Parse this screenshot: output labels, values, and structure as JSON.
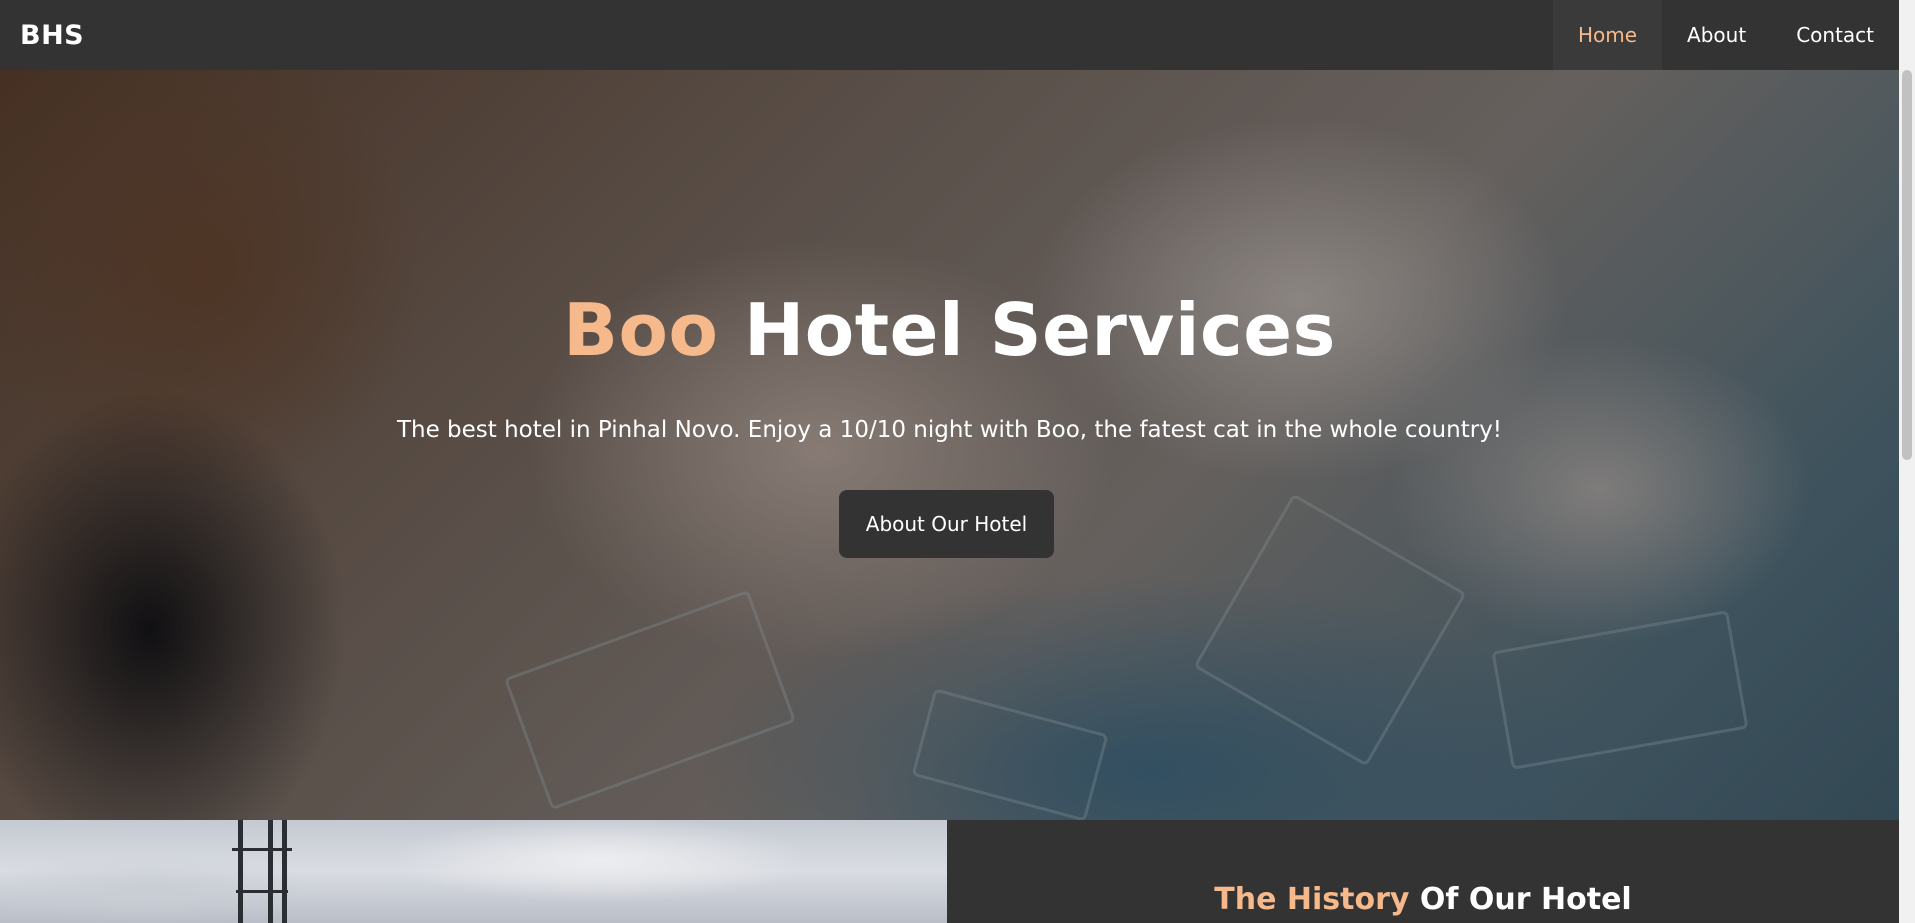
{
  "navbar": {
    "brand": "BHS",
    "items": [
      {
        "label": "Home",
        "active": true
      },
      {
        "label": "About",
        "active": false
      },
      {
        "label": "Contact",
        "active": false
      }
    ]
  },
  "hero": {
    "title_accent": "Boo",
    "title_rest": " Hotel Services",
    "subtitle": "The best hotel in Pinhal Novo. Enjoy a 10/10 night with Boo, the fatest cat in the whole country!",
    "button_label": "About Our Hotel"
  },
  "history": {
    "title_accent": "The History",
    "title_rest": " Of Our Hotel"
  },
  "colors": {
    "accent": "#f5b98b",
    "background": "#333333",
    "text": "#ffffff"
  }
}
